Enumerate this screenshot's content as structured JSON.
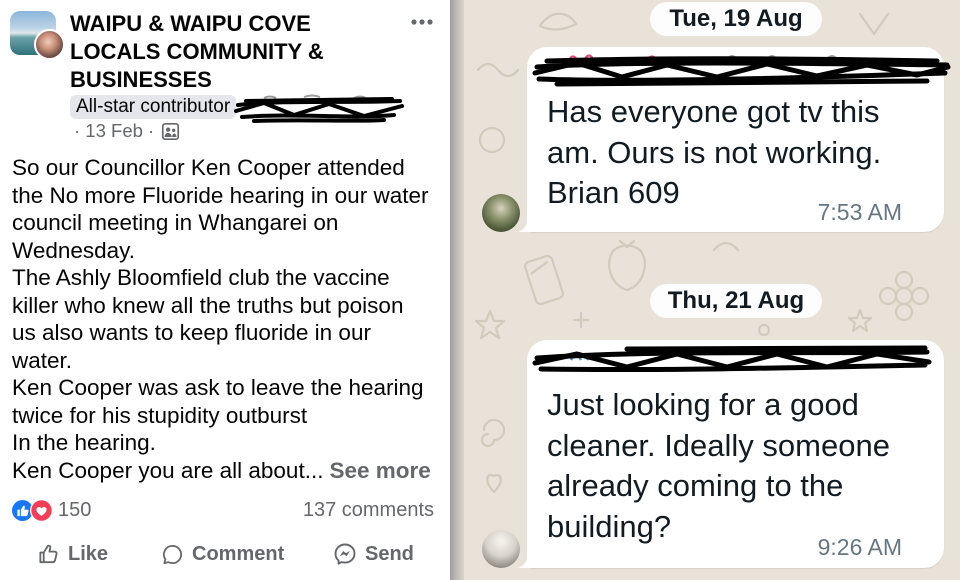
{
  "facebook_post": {
    "group_name": "WAIPU & WAIPU COVE LOCALS COMMUNITY & BUSINESSES",
    "group_avatar_icon": "group-cover-photo",
    "more_icon": "more-options-icon",
    "badge": "All-star contributor",
    "meta_text": "· 13 Feb ·",
    "audience_icon": "group-audience-icon",
    "body_lines": [
      "So our Councillor Ken Cooper attended",
      "the No more Fluoride hearing in our water",
      "council meeting in Whangarei on",
      "Wednesday.",
      "The Ashly Bloomfield club the vaccine",
      "killer who knew all the truths but poison",
      "us also wants to keep fluoride in our",
      "water.",
      "Ken Cooper was ask to leave the hearing",
      "twice for his stupidity outburst",
      "In the hearing.",
      "Ken Cooper you are all about..."
    ],
    "see_more": "See more",
    "reactions": {
      "icons": [
        "like-reaction-icon",
        "love-reaction-icon"
      ],
      "count": "150"
    },
    "comments_count": "137 comments",
    "actions": [
      {
        "label": "Like",
        "icon": "thumbs-up-icon"
      },
      {
        "label": "Comment",
        "icon": "comment-bubble-icon"
      },
      {
        "label": "Send",
        "icon": "messenger-send-icon"
      }
    ]
  },
  "chat": {
    "messages": [
      {
        "date": "Tue, 19 Aug",
        "lines": [
          "Has everyone got tv this",
          "am. Ours is not working.",
          "Brian 609"
        ],
        "time": "7:53 AM"
      },
      {
        "date": "Thu, 21 Aug",
        "lines": [
          "Just looking for a good",
          "cleaner. Ideally someone",
          "already coming to the",
          "building?"
        ],
        "time": "9:26 AM"
      }
    ]
  },
  "colors": {
    "fb_text": "#050505",
    "fb_secondary": "#65676b",
    "fb_badge_bg": "#e4e6eb",
    "like_blue": "#1877f2",
    "love_red": "#f33e58",
    "chat_wallpaper": "#e8e2d8",
    "bubble": "#ffffff",
    "chat_text": "#111b21",
    "chat_time": "#667781",
    "redaction": "#000000"
  }
}
